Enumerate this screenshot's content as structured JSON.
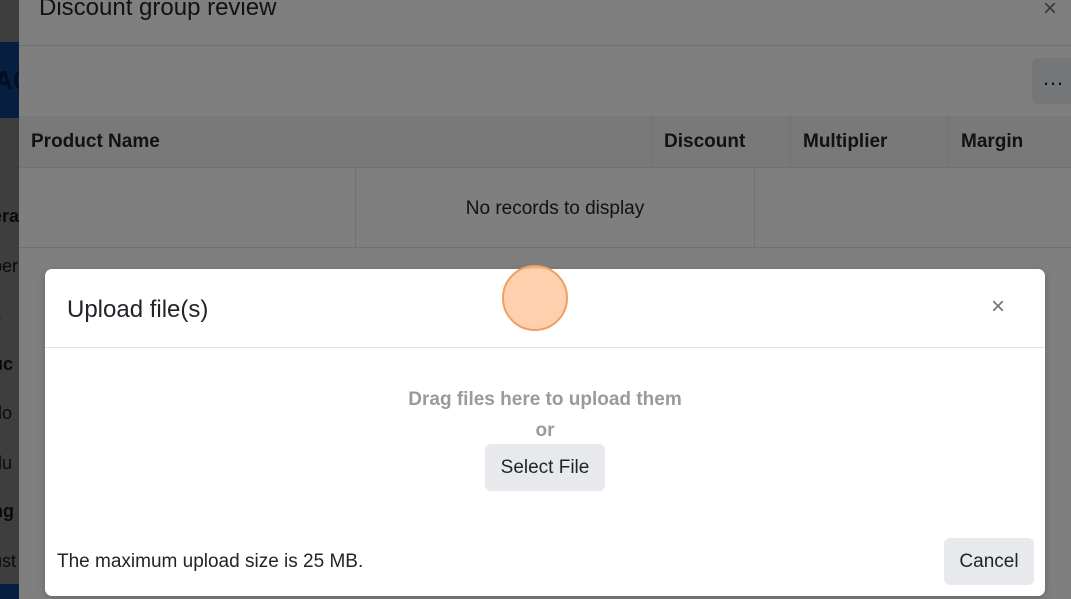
{
  "background_page": {
    "brand_fragment": "AC",
    "nav_fragments": [
      {
        "text": "era",
        "bold": true
      },
      {
        "text": "per",
        "bold": false
      },
      {
        "text": "s",
        "bold": false
      },
      {
        "text": "uc",
        "bold": true
      },
      {
        "text": "do",
        "bold": false
      },
      {
        "text": "du",
        "bold": false
      },
      {
        "text": "ng",
        "bold": true
      },
      {
        "text": "ust",
        "bold": false
      }
    ]
  },
  "main_modal": {
    "title": "Discount group review",
    "close_glyph": "×",
    "toolbar_more": "…",
    "grid": {
      "columns": [
        "Product Name",
        "Discount",
        "Multiplier",
        "Margin"
      ],
      "empty_text": "No records to display"
    }
  },
  "upload_dialog": {
    "title": "Upload file(s)",
    "close_glyph": "×",
    "drop_text": "Drag files here to upload them",
    "or_text": "or",
    "select_label": "Select File",
    "max_size_text": "The maximum upload size is 25 MB.",
    "cancel_label": "Cancel"
  },
  "colors": {
    "brand_blue": "#0d3f80",
    "backdrop": "rgba(0,0,0,0.5)",
    "button_bg": "#e7e9ec",
    "muted_text": "#9a9a9a",
    "cursor_fill": "#ffc8a0"
  }
}
